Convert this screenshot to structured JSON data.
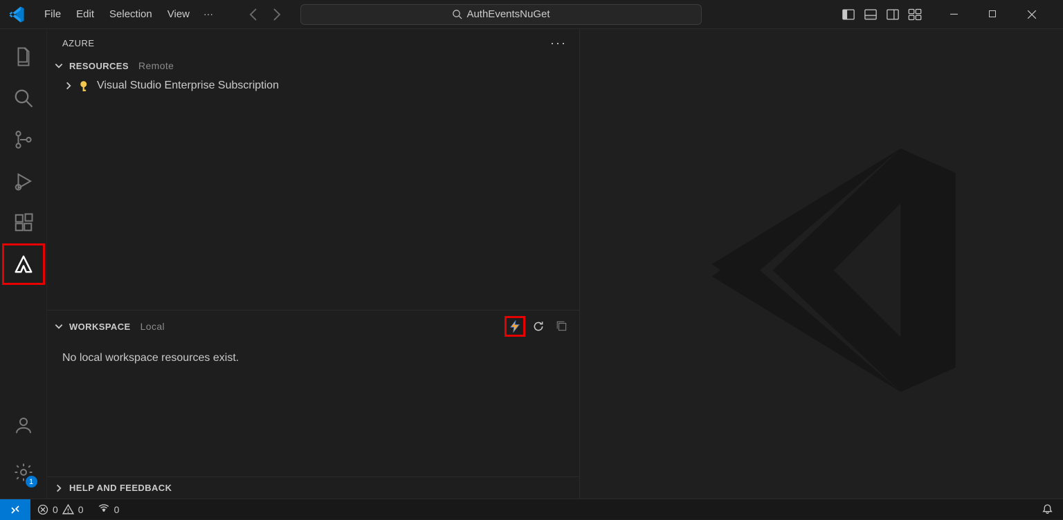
{
  "menu": {
    "file": "File",
    "edit": "Edit",
    "selection": "Selection",
    "view": "View",
    "overflow": "···"
  },
  "search": {
    "text": "AuthEventsNuGet"
  },
  "sidebar": {
    "title": "AZURE",
    "resources": {
      "header": "RESOURCES",
      "sub": "Remote",
      "item": "Visual Studio Enterprise Subscription"
    },
    "workspace": {
      "header": "WORKSPACE",
      "sub": "Local",
      "msg": "No local workspace resources exist."
    },
    "help": {
      "header": "HELP AND FEEDBACK"
    }
  },
  "status": {
    "errors": "0",
    "warnings": "0",
    "ports": "0"
  },
  "activity": {
    "settings_badge": "1"
  }
}
